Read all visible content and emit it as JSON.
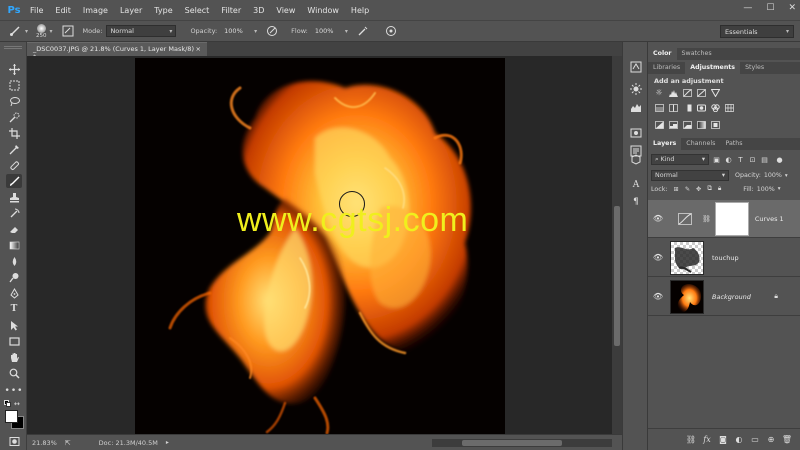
{
  "app": {
    "logo": "Ps",
    "menu": [
      "File",
      "Edit",
      "Image",
      "Layer",
      "Type",
      "Select",
      "Filter",
      "3D",
      "View",
      "Window",
      "Help"
    ],
    "window_controls": [
      "—",
      "☐",
      "✕"
    ]
  },
  "options_bar": {
    "brush_size": "250",
    "mode_label": "Mode:",
    "mode_value": "Normal",
    "opacity_label": "Opacity:",
    "opacity_value": "100%",
    "flow_label": "Flow:",
    "flow_value": "100%",
    "workspace": "Essentials"
  },
  "document": {
    "tab_title": "_DSC0037.JPG @ 21.8% (Curves 1, Layer Mask/8) *",
    "tab_close": "×",
    "watermark": "www.cgtsj.com"
  },
  "status_bar": {
    "zoom": "21.83%",
    "doc_info": "Doc: 21.3M/40.5M"
  },
  "panels": {
    "top_tabs": [
      "Color",
      "Swatches"
    ],
    "mid_tabs": [
      "Libraries",
      "Adjustments",
      "Styles"
    ],
    "add_adjustment": "Add an adjustment",
    "layer_tabs": [
      "Layers",
      "Channels",
      "Paths"
    ],
    "filter_kind": "Kind",
    "blend_mode": "Normal",
    "opacity_label": "Opacity:",
    "opacity_value": "100%",
    "lock_label": "Lock:",
    "fill_label": "Fill:",
    "fill_value": "100%"
  },
  "layers": [
    {
      "name": "Curves 1",
      "visible": true,
      "selected": true,
      "italic": false
    },
    {
      "name": "touchup",
      "visible": true,
      "selected": false,
      "italic": false
    },
    {
      "name": "Background",
      "visible": true,
      "selected": false,
      "italic": true,
      "locked": true
    }
  ],
  "colors": {
    "ui_bg": "#535353",
    "canvas_bg": "#282828",
    "watermark": "#f0ef1d",
    "fire_core": "#ffd75a",
    "fire_mid": "#ff7a10",
    "fire_edge": "#b52a00"
  }
}
